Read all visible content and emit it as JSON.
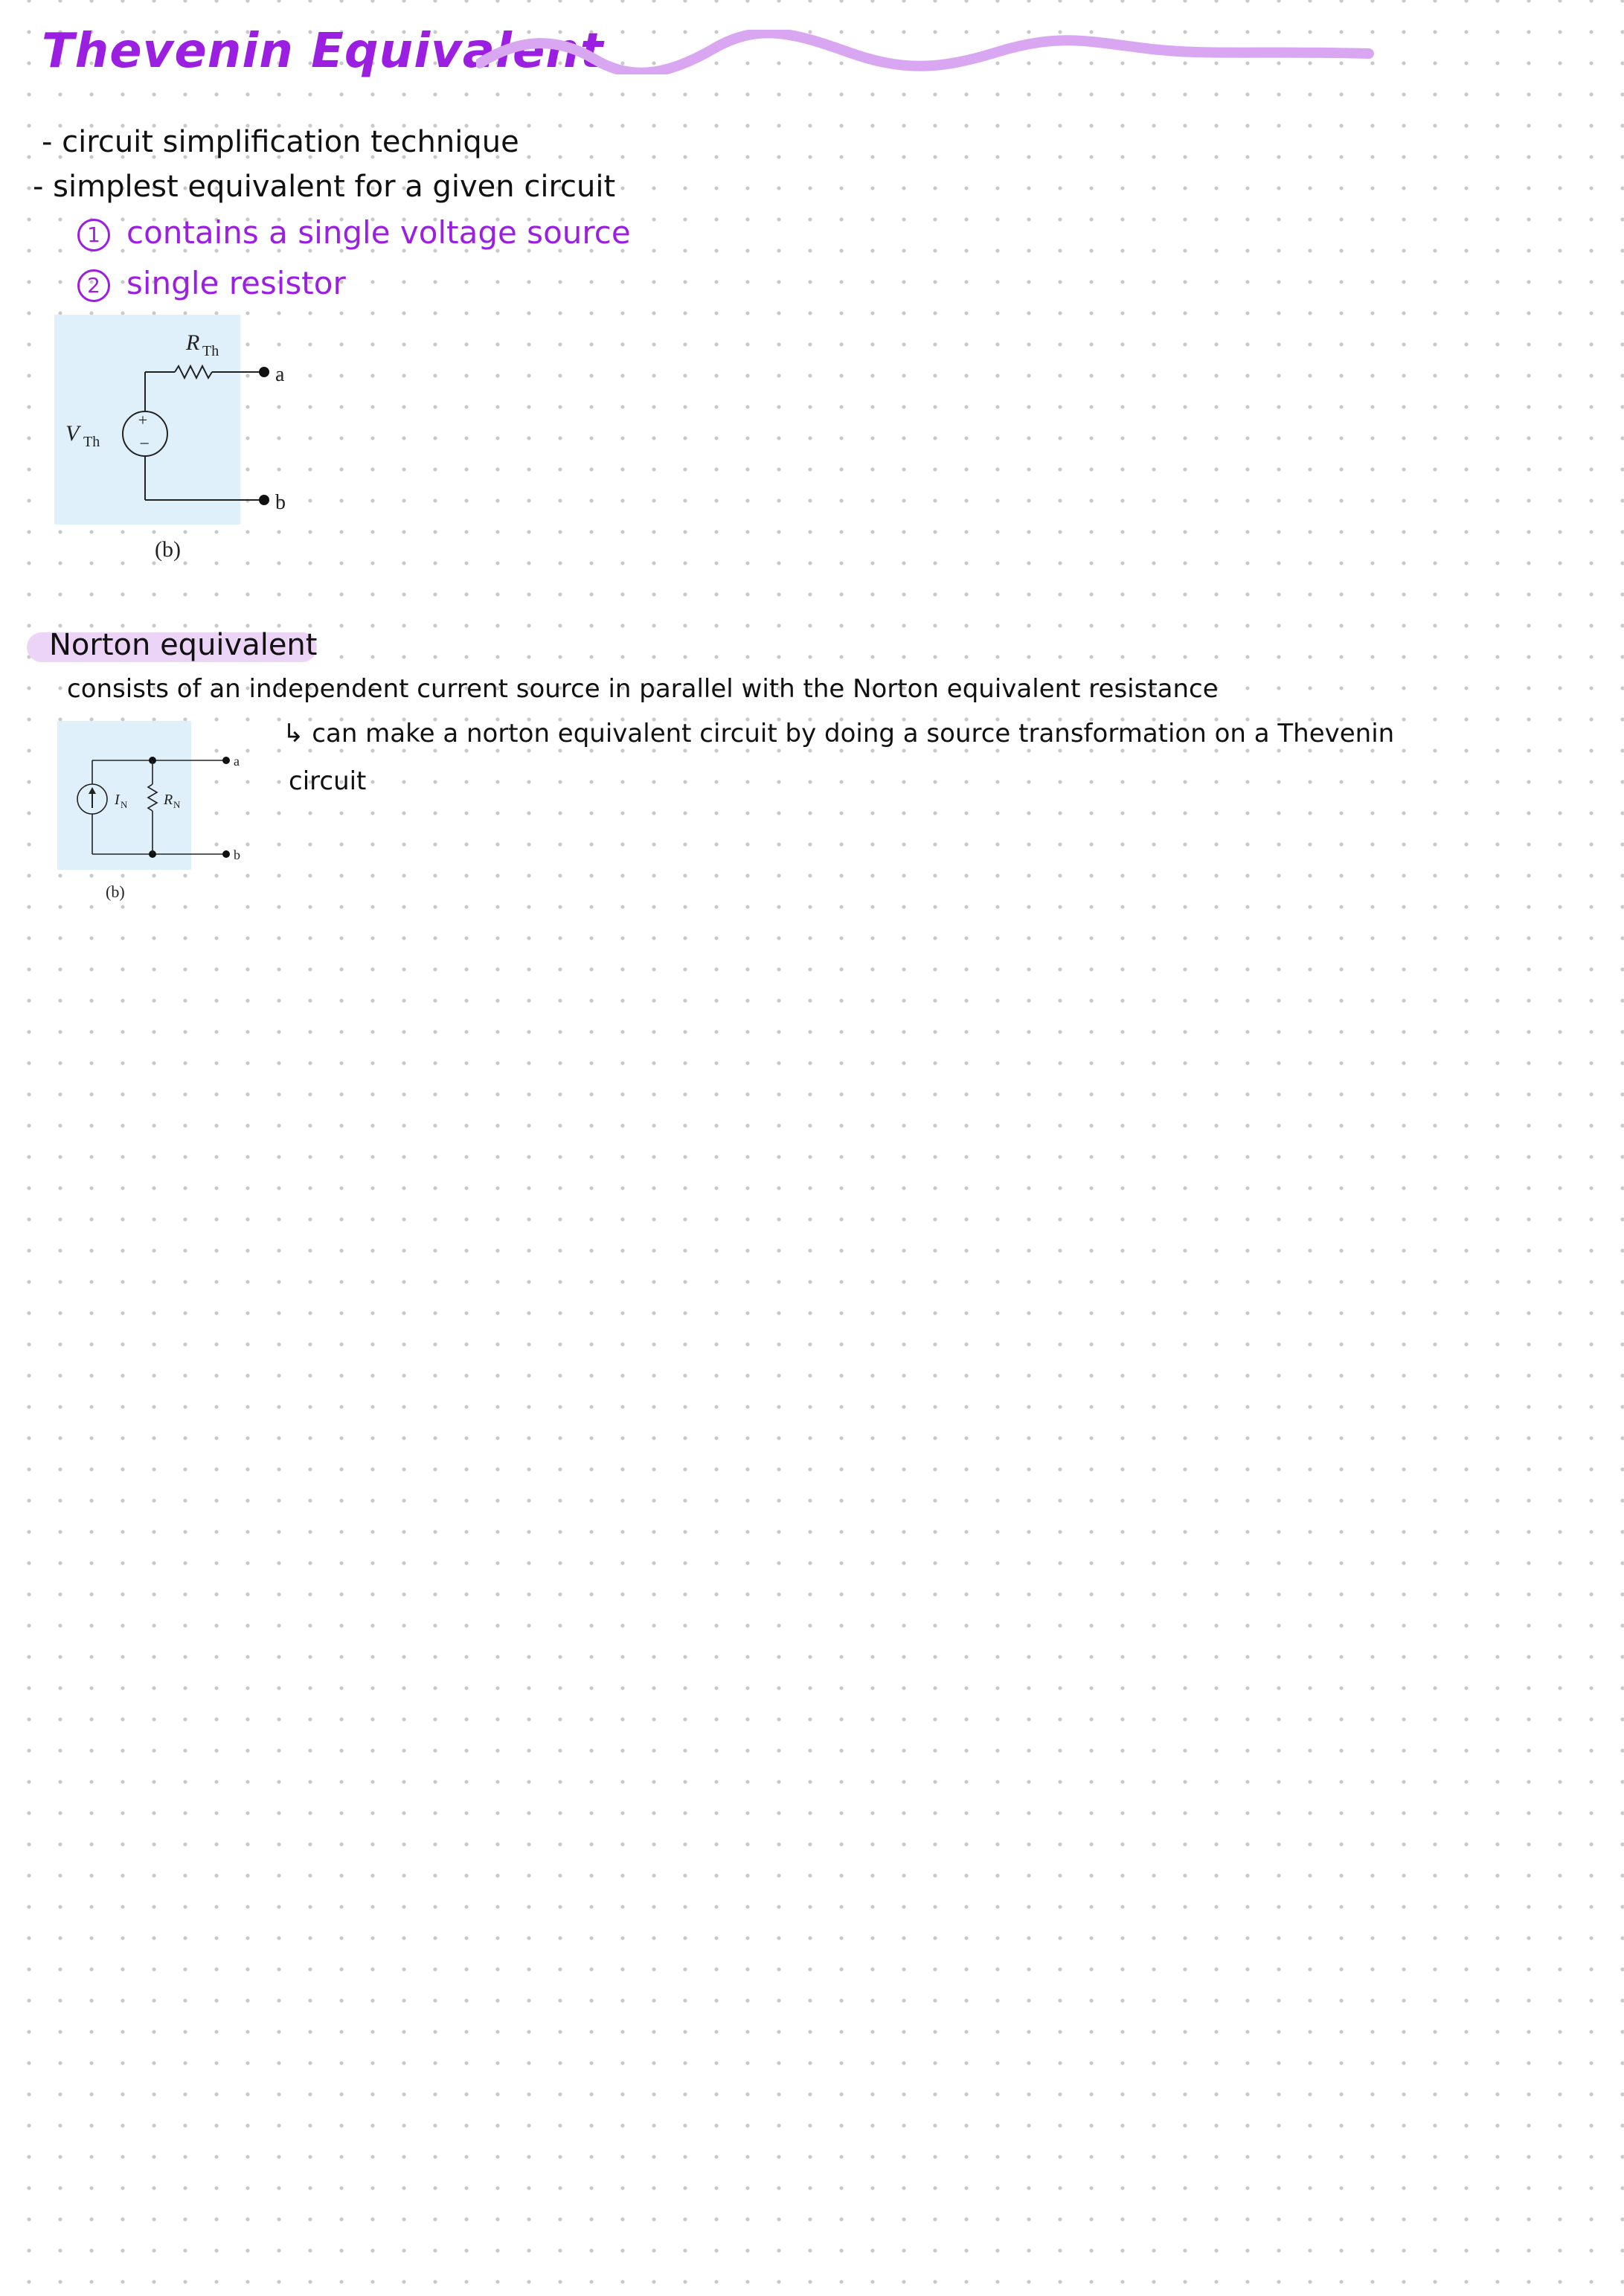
{
  "title": "Thevenin Equivalent",
  "thevenin": {
    "bullets": [
      "- circuit simplification technique",
      "- simplest equivalent for a given circuit"
    ],
    "numbered": [
      {
        "num": "1",
        "text": "contains a single voltage source"
      },
      {
        "num": "2",
        "text": "single resistor"
      }
    ],
    "figure": {
      "resistor_label": "R",
      "resistor_sub": "Th",
      "source_label": "V",
      "source_sub": "Th",
      "plus": "+",
      "minus": "−",
      "terminal_a": "a",
      "terminal_b": "b",
      "caption": "(b)"
    }
  },
  "norton": {
    "heading": "Norton equivalent",
    "line1": "consists of an independent current source in parallel with the Norton equivalent resistance",
    "line2": "↳ can make a norton equivalent circuit by doing a source transformation on a Thevenin",
    "line3": "circuit",
    "figure": {
      "current_label": "I",
      "current_sub": "N",
      "resistor_label": "R",
      "resistor_sub": "N",
      "terminal_a": "a",
      "terminal_b": "b",
      "caption": "(b)"
    }
  },
  "colors": {
    "accent": "#9b1fe0",
    "highlight": "#ecd4f6",
    "figure_bg": "#dff0fb"
  }
}
